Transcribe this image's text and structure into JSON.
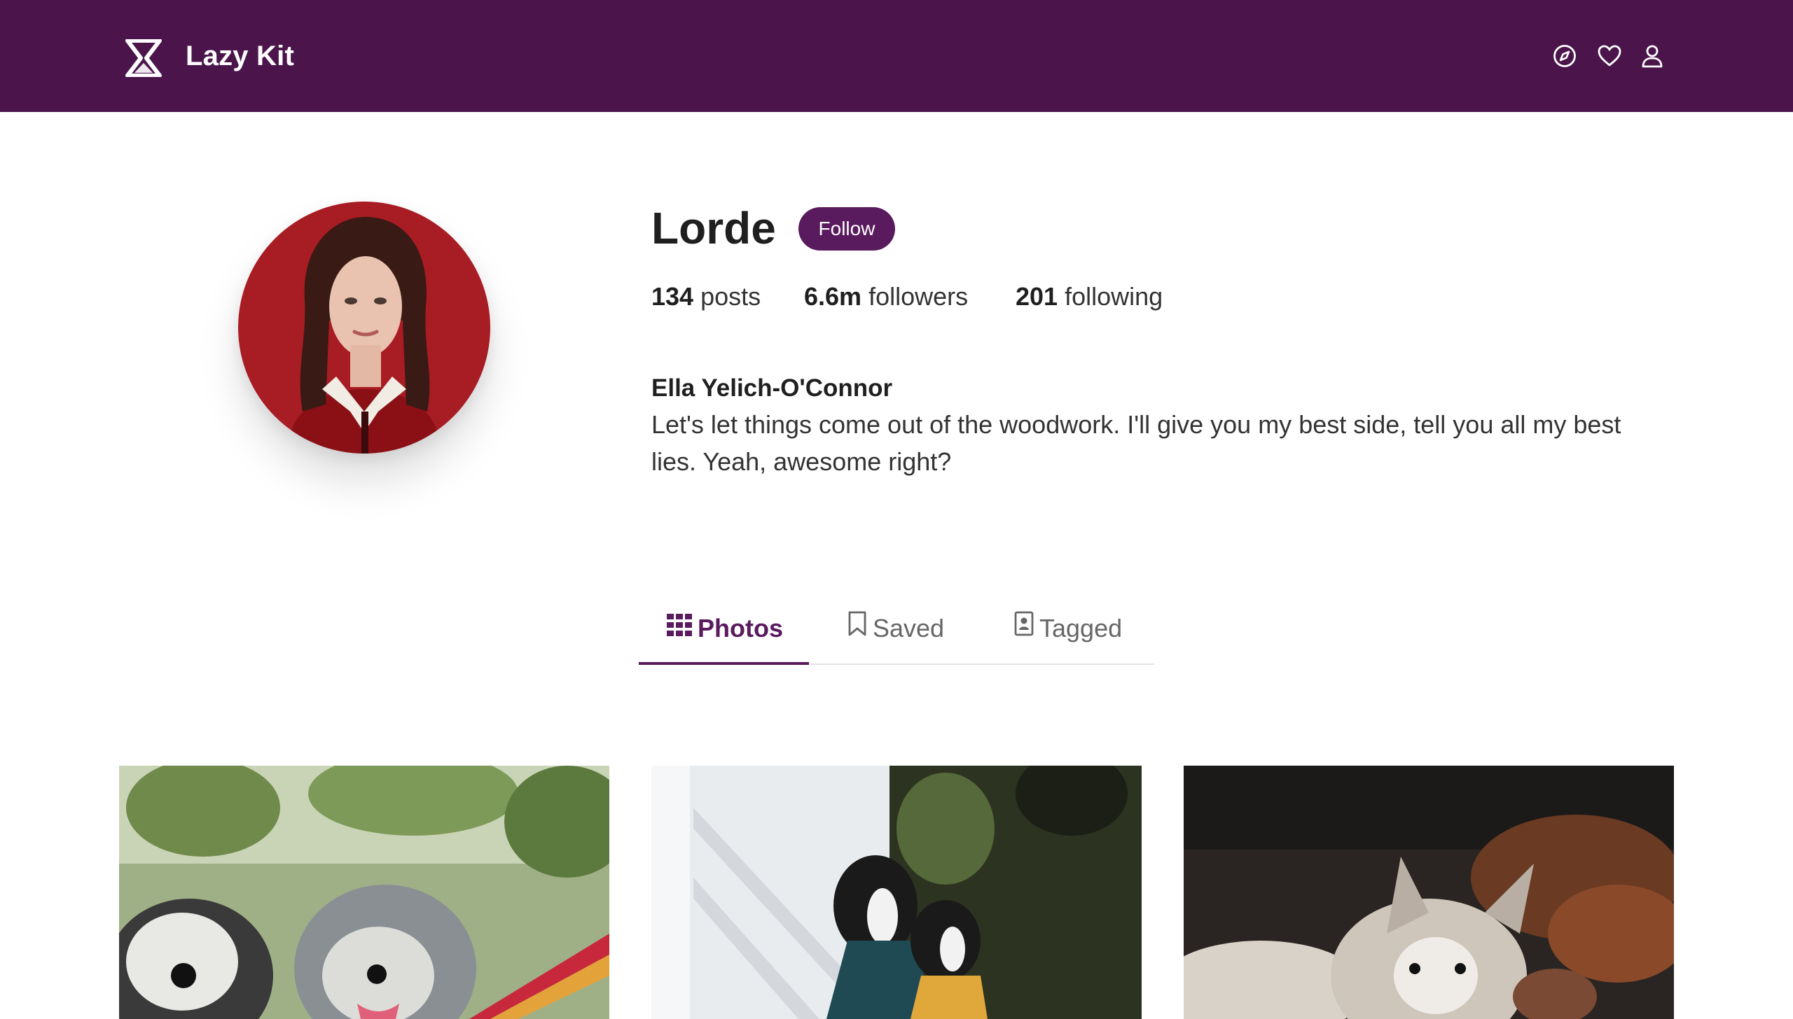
{
  "app": {
    "name": "Lazy Kit"
  },
  "nav": {
    "icons": [
      "compass-icon",
      "heart-icon",
      "user-icon"
    ]
  },
  "profile": {
    "username": "Lorde",
    "follow_label": "Follow",
    "stats": [
      {
        "value": "134",
        "label": "posts"
      },
      {
        "value": "6.6m",
        "label": "followers"
      },
      {
        "value": "201",
        "label": "following"
      }
    ],
    "full_name": "Ella Yelich-O'Connor",
    "bio": "Let's let things come out of the woodwork. I'll give you my best side, tell you all my best lies. Yeah, awesome right?"
  },
  "tabs": [
    {
      "label": "Photos",
      "icon": "grid-icon",
      "active": true
    },
    {
      "label": "Saved",
      "icon": "bookmark-icon",
      "active": false
    },
    {
      "label": "Tagged",
      "icon": "contact-badge-icon",
      "active": false
    }
  ],
  "colors": {
    "brand": "#4b154b",
    "accent": "#5a1a5e"
  }
}
